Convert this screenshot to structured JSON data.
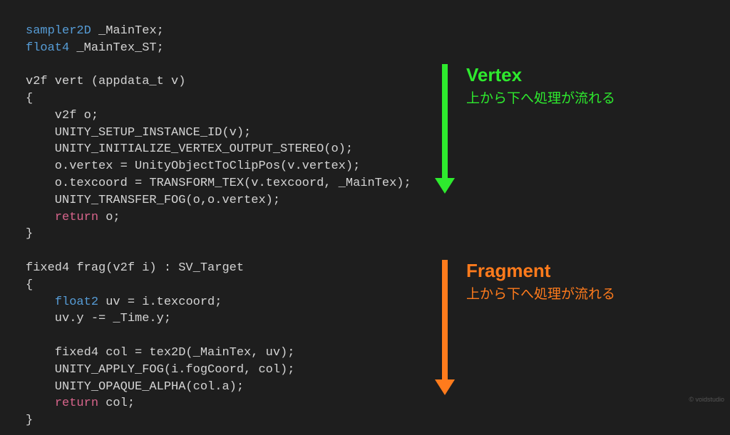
{
  "code": {
    "l1a": "sampler2D",
    "l1b": " _MainTex;",
    "l2a": "float4",
    "l2b": " _MainTex_ST;",
    "l3": "",
    "l4": "v2f vert (appdata_t v)",
    "l5": "{",
    "l6": "    v2f o;",
    "l7": "    UNITY_SETUP_INSTANCE_ID(v);",
    "l8": "    UNITY_INITIALIZE_VERTEX_OUTPUT_STEREO(o);",
    "l9": "    o.vertex = UnityObjectToClipPos(v.vertex);",
    "l10": "    o.texcoord = TRANSFORM_TEX(v.texcoord, _MainTex);",
    "l11": "    UNITY_TRANSFER_FOG(o,o.vertex);",
    "l12a": "    ",
    "l12b": "return",
    "l12c": " o;",
    "l13": "}",
    "l14": "",
    "l15": "fixed4 frag(v2f i) : SV_Target",
    "l16": "{",
    "l17a": "    ",
    "l17b": "float2",
    "l17c": " uv = i.texcoord;",
    "l18": "    uv.y -= _Time.y;",
    "l19": "",
    "l20": "    fixed4 col = tex2D(_MainTex, uv);",
    "l21": "    UNITY_APPLY_FOG(i.fogCoord, col);",
    "l22": "    UNITY_OPAQUE_ALPHA(col.a);",
    "l23a": "    ",
    "l23b": "return",
    "l23c": " col;",
    "l24": "}"
  },
  "annotations": {
    "vertex": {
      "title": "Vertex",
      "subtitle": "上から下へ処理が流れる"
    },
    "fragment": {
      "title": "Fragment",
      "subtitle": "上から下へ処理が流れる"
    }
  },
  "watermark": "© voidstudio"
}
